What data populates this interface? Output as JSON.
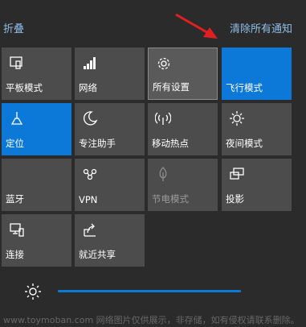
{
  "header": {
    "collapse_label": "折叠",
    "clear_all_label": "清除所有通知"
  },
  "tiles": [
    {
      "label": "平板模式",
      "icon": "tablet-mode-icon",
      "state": "normal"
    },
    {
      "label": "网络",
      "icon": "network-signal-icon",
      "state": "normal"
    },
    {
      "label": "所有设置",
      "icon": "gear-icon",
      "state": "hover"
    },
    {
      "label": "飞行模式",
      "icon": "airplane-icon",
      "state": "active"
    },
    {
      "label": "定位",
      "icon": "location-icon",
      "state": "active"
    },
    {
      "label": "专注助手",
      "icon": "moon-icon",
      "state": "normal"
    },
    {
      "label": "移动热点",
      "icon": "hotspot-icon",
      "state": "normal"
    },
    {
      "label": "夜间模式",
      "icon": "night-light-icon",
      "state": "normal"
    },
    {
      "label": "蓝牙",
      "icon": "bluetooth-icon",
      "state": "normal"
    },
    {
      "label": "VPN",
      "icon": "vpn-icon",
      "state": "normal"
    },
    {
      "label": "节电模式",
      "icon": "battery-saver-icon",
      "state": "disabled"
    },
    {
      "label": "投影",
      "icon": "project-icon",
      "state": "normal"
    },
    {
      "label": "连接",
      "icon": "connect-icon",
      "state": "normal"
    },
    {
      "label": "就近共享",
      "icon": "nearby-share-icon",
      "state": "normal"
    }
  ],
  "brightness": {
    "icon": "brightness-sun-icon",
    "level": 100
  },
  "watermark": "www.toymoban.com 网络图片仅供展示，非存储，如有侵权请联系删除。",
  "colors": {
    "background": "#2b2b2b",
    "tile": "#4c4c4c",
    "tile_active": "#0c79d8",
    "link": "#8fbde8",
    "arrow": "#e02020"
  }
}
